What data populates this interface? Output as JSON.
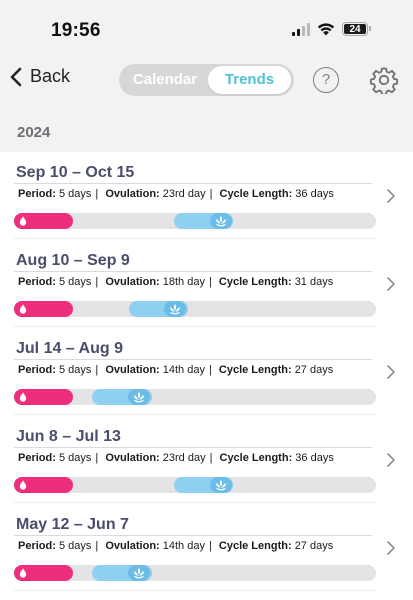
{
  "status_bar": {
    "time": "19:56",
    "battery": "24",
    "icons": [
      "cellular-signal-icon",
      "wifi-icon",
      "battery-icon"
    ]
  },
  "nav": {
    "back_label": "Back",
    "tabs": [
      {
        "label": "Calendar",
        "selected": false
      },
      {
        "label": "Trends",
        "selected": true
      }
    ],
    "help_label": "?",
    "icons": [
      "chevron-left-icon",
      "help-icon",
      "gear-icon"
    ]
  },
  "year": "2024",
  "labels": {
    "period": "Period:",
    "ovulation": "Ovulation:",
    "cycle_length": "Cycle Length:"
  },
  "colors": {
    "period": "#ee2e7a",
    "fertile": "#8fcfef",
    "ovulation": "#6cbce8",
    "accent": "#4fc3d4"
  },
  "cycles": [
    {
      "range": "Sep 10 – Oct 15",
      "period": "5 days",
      "ovulation": "23rd day",
      "cycle_length": "36 days",
      "period_days": 5,
      "ovulation_day": 23,
      "length_days": 36
    },
    {
      "range": "Aug 10 – Sep 9",
      "period": "5 days",
      "ovulation": "18th day",
      "cycle_length": "31 days",
      "period_days": 5,
      "ovulation_day": 18,
      "length_days": 31
    },
    {
      "range": "Jul 14 – Aug 9",
      "period": "5 days",
      "ovulation": "14th day",
      "cycle_length": "27 days",
      "period_days": 5,
      "ovulation_day": 14,
      "length_days": 27
    },
    {
      "range": "Jun 8 – Jul 13",
      "period": "5 days",
      "ovulation": "23rd day",
      "cycle_length": "36 days",
      "period_days": 5,
      "ovulation_day": 23,
      "length_days": 36
    },
    {
      "range": "May 12 – Jun 7",
      "period": "5 days",
      "ovulation": "14th day",
      "cycle_length": "27 days",
      "period_days": 5,
      "ovulation_day": 14,
      "length_days": 27
    }
  ]
}
